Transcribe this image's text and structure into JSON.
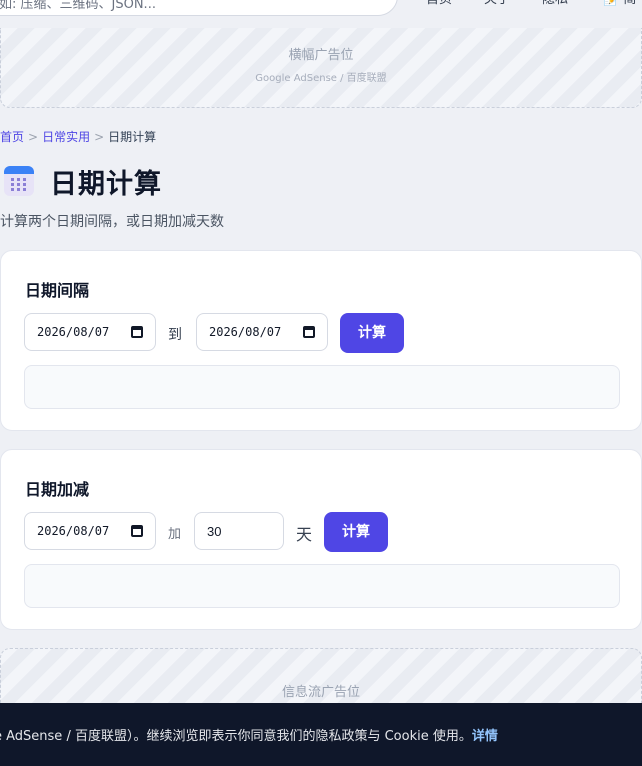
{
  "header": {
    "search_placeholder": "如: 压缩、三维码、JSON...",
    "nav": [
      "首页",
      "关于",
      "隐私",
      "📝 简"
    ]
  },
  "ads": {
    "top": {
      "title": "横幅广告位",
      "subtitle": "Google AdSense / 百度联盟"
    },
    "feed": {
      "title": "信息流广告位"
    }
  },
  "breadcrumb": {
    "home": "首页",
    "sep": ">",
    "category": "日常实用",
    "current": "日期计算"
  },
  "page": {
    "title": "日期计算",
    "description": "计算两个日期间隔，或日期加减天数"
  },
  "interval_card": {
    "title": "日期间隔",
    "start_date": "2026/08/07",
    "to_label": "到",
    "end_date": "2026/08/07",
    "button": "计算"
  },
  "add_card": {
    "title": "日期加减",
    "base_date": "2026/08/07",
    "add_label": "加",
    "days_value": "30",
    "unit_label": "天",
    "button": "计算"
  },
  "cookie": {
    "text": "e AdSense / 百度联盟）。继续浏览即表示你同意我们的隐私政策与 Cookie 使用。",
    "link": "详情"
  },
  "colors": {
    "accent": "#4f46e5",
    "cookie_bg": "#0f172a",
    "link": "#93c5fd"
  }
}
